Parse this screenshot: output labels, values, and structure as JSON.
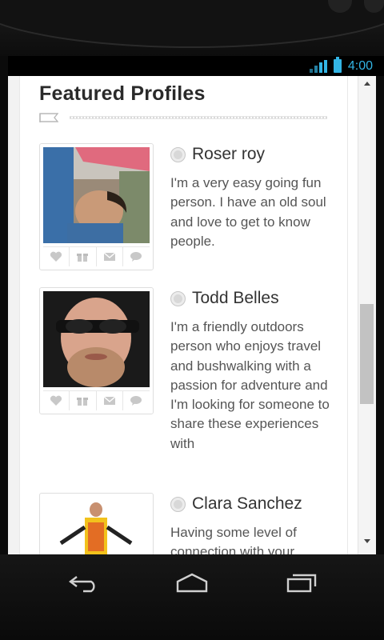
{
  "status_bar": {
    "time": "4:00",
    "icons": [
      "signal-icon",
      "battery-icon"
    ],
    "accent_color": "#33b5e5"
  },
  "featured": {
    "title": "Featured Profiles"
  },
  "profiles": [
    {
      "name": "Roser roy",
      "bio": "I'm a very easy going fun person. I have an old soul and love to get to know people.",
      "actions": [
        "heart-icon",
        "gift-icon",
        "mail-icon",
        "chat-icon"
      ]
    },
    {
      "name": "Todd Belles",
      "bio": "I'm a friendly outdoors person who enjoys travel and bushwalking with a passion for adventure and I'm looking for someone to share these experiences with",
      "actions": [
        "heart-icon",
        "gift-icon",
        "mail-icon",
        "chat-icon"
      ]
    },
    {
      "name": "Clara Sanchez",
      "bio": "Having some level of connection with your"
    }
  ],
  "nav_bar": {
    "buttons": [
      "back-icon",
      "home-icon",
      "recent-apps-icon"
    ]
  }
}
